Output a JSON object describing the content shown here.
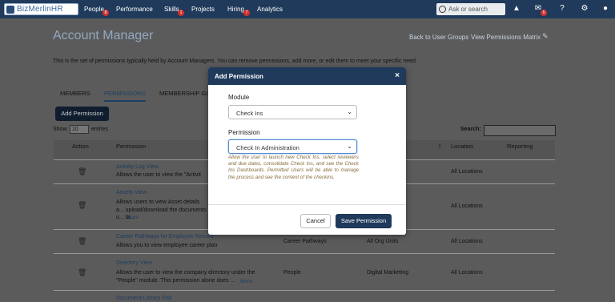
{
  "topbar": {
    "brand": "BizMerlinHR",
    "nav": [
      {
        "label": "People",
        "badge": "8"
      },
      {
        "label": "Performance",
        "badge": ""
      },
      {
        "label": "Skills",
        "badge": "1"
      },
      {
        "label": "Projects",
        "badge": ""
      },
      {
        "label": "Hiring",
        "badge": "7"
      },
      {
        "label": "Analytics",
        "badge": ""
      }
    ],
    "search_placeholder": "Ask or search",
    "mail_badge": "6"
  },
  "page": {
    "title": "Account Manager",
    "back_link": "Back to User Groups",
    "matrix_link": "View Permissions Matrix",
    "description": "This is the set of permissions typically held by Account Managers. You can remove permissions, add more, or edit them to meet your specific need.",
    "tabs": [
      "MEMBERS",
      "PERMISSIONS",
      "MEMBERSHIP GU"
    ],
    "add_button": "Add Permission",
    "show_label": "Show",
    "entries_value": "10",
    "entries_label": "entries",
    "search_label": "Search:"
  },
  "table": {
    "headers": {
      "action": "Action",
      "permission": "Permission",
      "location": "Location",
      "reporting": "Reporting"
    },
    "rows": [
      {
        "name": "Activity Log View",
        "desc": "Allows the user to view the \"Activit",
        "more": "",
        "module": "",
        "scope": "",
        "location": "All Locations"
      },
      {
        "name": "Assets View",
        "desc": "Allows users to view Asset details a... upload/download the documents u... ta...",
        "more": "More",
        "module": "",
        "scope": "",
        "location": "All Locations"
      },
      {
        "name": "Career Pathways for Employee Record",
        "desc": "Allows you to view employee career plan",
        "more": "",
        "module": "Career Pathways",
        "scope": "All Org Units",
        "location": "All Locations"
      },
      {
        "name": "Directory View",
        "desc": "Allows the user to view the company directory under the \"People\" module. This permission alone does ...",
        "more": "More",
        "module": "People",
        "scope": "Digital Marketing",
        "location": "All Locations"
      },
      {
        "name": "Document Library Edit",
        "desc": "",
        "more": "",
        "module": "",
        "scope": "",
        "location": ""
      }
    ]
  },
  "modal": {
    "title": "Add Permission",
    "module_label": "Module",
    "module_value": "Check Ins",
    "permission_label": "Permission",
    "permission_value": "Check In Administration",
    "help": "Allow the user to launch new Check Ins, select reviewers and due dates, consolidate Check Ins, and see the Check Ins Dashboards. Permitted Users will be able to manage the process and see the content of the checkins.",
    "cancel": "Cancel",
    "save": "Save Permission"
  }
}
